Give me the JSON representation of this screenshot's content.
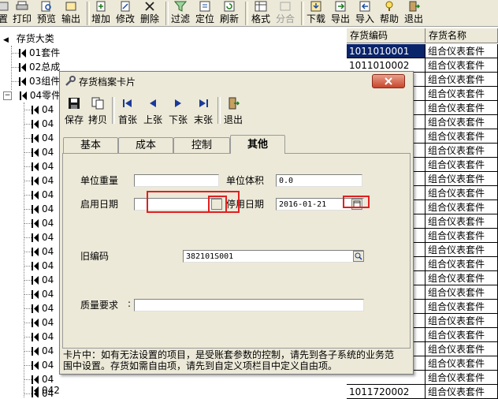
{
  "toolbar": {
    "buttons": [
      "置",
      "打印",
      "预览",
      "输出",
      "增加",
      "修改",
      "删除",
      "过滤",
      "定位",
      "刷新",
      "格式",
      "分合",
      "下载",
      "导出",
      "导入",
      "帮助",
      "退出"
    ]
  },
  "tree": {
    "root": "存货大类",
    "items": [
      "01套件",
      "02总成",
      "03组件",
      "04零件"
    ],
    "sub_items": [
      "04",
      "04",
      "04",
      "04",
      "04",
      "04",
      "04",
      "04",
      "04",
      "04",
      "04",
      "04",
      "04",
      "04",
      "04",
      "04",
      "04",
      "04",
      "04",
      "04",
      "04",
      "04"
    ],
    "bottom_items": [
      "042"
    ]
  },
  "grid": {
    "headers": [
      "存货编码",
      "存货名称"
    ],
    "rows": [
      {
        "code": "1011010001",
        "name": "组合仪表套件"
      },
      {
        "code": "1011010002",
        "name": "组合仪表套件"
      },
      {
        "code": "",
        "name": "组合仪表套件"
      },
      {
        "code": "",
        "name": "组合仪表套件"
      },
      {
        "code": "",
        "name": "组合仪表套件"
      },
      {
        "code": "",
        "name": "组合仪表套件"
      },
      {
        "code": "",
        "name": "组合仪表套件"
      },
      {
        "code": "",
        "name": "组合仪表套件"
      },
      {
        "code": "",
        "name": "组合仪表套件"
      },
      {
        "code": "",
        "name": "组合仪表套件"
      },
      {
        "code": "",
        "name": "组合仪表套件"
      },
      {
        "code": "",
        "name": "组合仪表套件"
      },
      {
        "code": "",
        "name": "组合仪表套件"
      },
      {
        "code": "",
        "name": "组合仪表套件"
      },
      {
        "code": "",
        "name": "组合仪表套件"
      },
      {
        "code": "",
        "name": "组合仪表套件"
      },
      {
        "code": "",
        "name": "组合仪表套件"
      },
      {
        "code": "",
        "name": "组合仪表套件"
      },
      {
        "code": "",
        "name": "组合仪表套件"
      },
      {
        "code": "",
        "name": "组合仪表套件"
      },
      {
        "code": "",
        "name": "组合仪表套件"
      },
      {
        "code": "",
        "name": "组合仪表套件"
      },
      {
        "code": "",
        "name": "组合仪表套件"
      },
      {
        "code": "",
        "name": "组合仪表套件"
      },
      {
        "code": "1011720002",
        "name": "组合仪表套件"
      }
    ]
  },
  "dialog": {
    "title": "存货档案卡片",
    "toolbar": [
      "保存",
      "拷贝",
      "首张",
      "上张",
      "下张",
      "末张",
      "退出"
    ],
    "tabs": [
      "基本",
      "成本",
      "控制",
      "其他"
    ],
    "fields": {
      "unit_weight_label": "单位重量",
      "unit_weight_value": "",
      "unit_volume_label": "单位体积",
      "unit_volume_value": "0.0",
      "start_date_label": "启用日期",
      "start_date_value": "",
      "stop_date_label": "停用日期",
      "stop_date_label_visible": "停用日期",
      "stop_date_value": "2016-01-21",
      "old_code_label": "旧编码",
      "old_code_value": "382101S001",
      "quality_label": "质量要求",
      "quality_value": ""
    },
    "note_line1": "卡片中：如有无法设置的项目，是受账套参数的控制，请先到各子系统的业务范",
    "note_line2": "围中设置。存货如需自由项，请先到自定义项栏目中定义自由项。"
  },
  "colors": {
    "selected_bg": "#0a246a",
    "highlight_red": "#e02020",
    "window_bg": "#ece9d8"
  }
}
